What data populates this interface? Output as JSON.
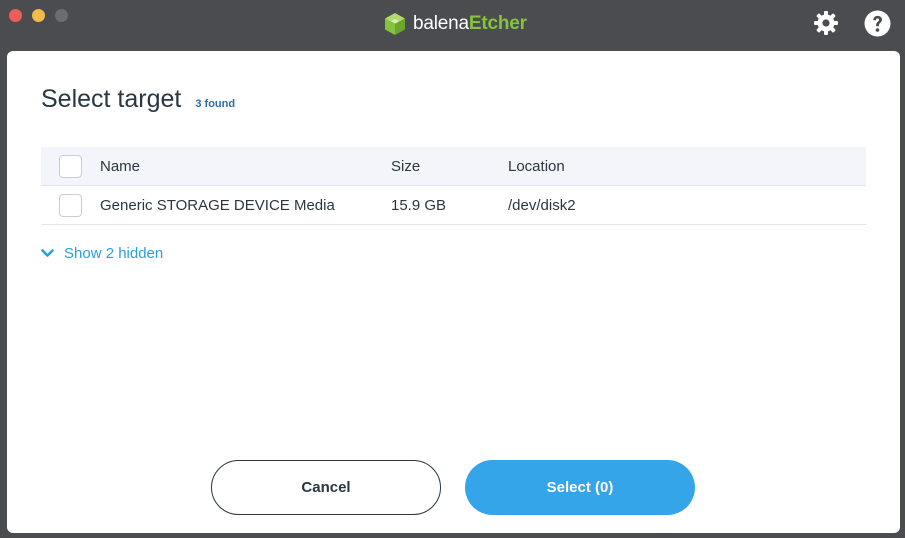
{
  "app": {
    "brand_prefix": "balena",
    "brand_suffix": "Etcher",
    "brand_color": "#85c33d"
  },
  "toolbar": {
    "settings_icon": "gear-icon",
    "help_icon": "question-icon"
  },
  "dialog": {
    "title": "Select target",
    "found_count": "3 found",
    "columns": {
      "name": "Name",
      "size": "Size",
      "location": "Location"
    },
    "drives": [
      {
        "name": "Generic STORAGE DEVICE Media",
        "size": "15.9 GB",
        "location": "/dev/disk2",
        "selected": false
      }
    ],
    "show_hidden_label": "Show 2 hidden",
    "cancel_label": "Cancel",
    "select_label": "Select (0)",
    "accent_color": "#35a5ea"
  }
}
